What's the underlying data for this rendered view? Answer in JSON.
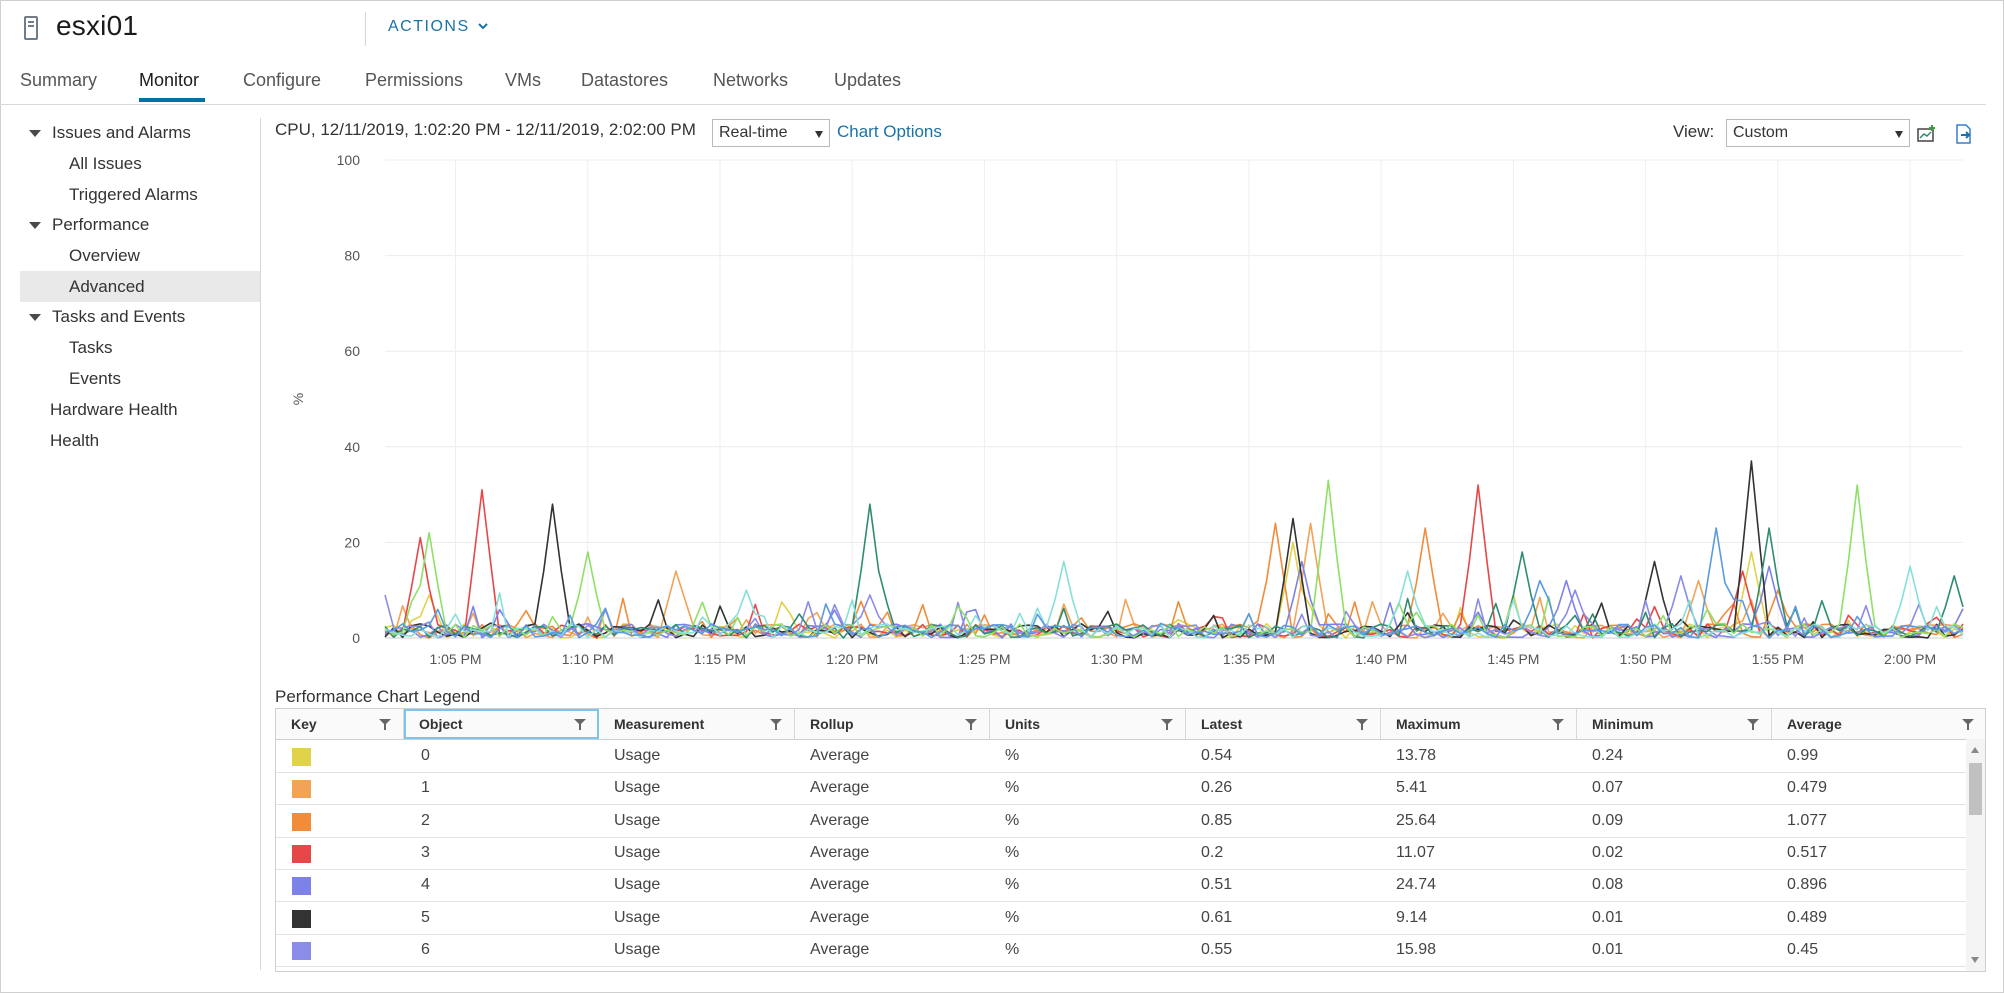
{
  "header": {
    "title": "esxi01",
    "actions_label": "ACTIONS"
  },
  "tabs": [
    {
      "label": "Summary",
      "active": false
    },
    {
      "label": "Monitor",
      "active": true
    },
    {
      "label": "Configure",
      "active": false
    },
    {
      "label": "Permissions",
      "active": false
    },
    {
      "label": "VMs",
      "active": false
    },
    {
      "label": "Datastores",
      "active": false
    },
    {
      "label": "Networks",
      "active": false
    },
    {
      "label": "Updates",
      "active": false
    }
  ],
  "sidebar": {
    "groups": [
      {
        "label": "Issues and Alarms",
        "expanded": true,
        "children": [
          "All Issues",
          "Triggered Alarms"
        ]
      },
      {
        "label": "Performance",
        "expanded": true,
        "children": [
          "Overview",
          "Advanced"
        ]
      },
      {
        "label": "Tasks and Events",
        "expanded": true,
        "children": [
          "Tasks",
          "Events"
        ]
      }
    ],
    "items": [
      "Hardware Health",
      "Health"
    ],
    "selected": "Advanced"
  },
  "chart_header": {
    "title": "CPU, 12/11/2019, 1:02:20 PM - 12/11/2019, 2:02:00 PM",
    "period_value": "Real-time",
    "chart_options_label": "Chart Options",
    "view_label": "View:",
    "view_value": "Custom",
    "icons": [
      "new-chart-icon",
      "export-icon"
    ]
  },
  "chart_data": {
    "type": "line",
    "ylabel": "%",
    "ylim": [
      0,
      100
    ],
    "yticks": [
      0,
      20,
      40,
      60,
      80,
      100
    ],
    "x_tick_labels": [
      "1:05 PM",
      "1:10 PM",
      "1:15 PM",
      "1:20 PM",
      "1:25 PM",
      "1:30 PM",
      "1:35 PM",
      "1:40 PM",
      "1:45 PM",
      "1:50 PM",
      "1:55 PM",
      "2:00 PM"
    ],
    "x_start": "1:02:20 PM",
    "x_end": "2:02:00 PM",
    "grid": true,
    "series": [
      {
        "color": "#e0d24a",
        "peaks": [
          [
            "1:04:00 PM",
            9
          ],
          [
            "1:36:40 PM",
            20
          ],
          [
            "1:54:00 PM",
            18
          ]
        ]
      },
      {
        "color": "#f2a356",
        "peaks": [
          [
            "1:13:20 PM",
            14
          ],
          [
            "1:37:20 PM",
            24
          ],
          [
            "1:52:00 PM",
            12
          ]
        ]
      },
      {
        "color": "#f08c3a",
        "peaks": [
          [
            "1:36:00 PM",
            24
          ],
          [
            "1:41:40 PM",
            23
          ],
          [
            "1:55:00 PM",
            10
          ]
        ]
      },
      {
        "color": "#e8474a",
        "peaks": [
          [
            "1:03:40 PM",
            21
          ],
          [
            "1:06:00 PM",
            31
          ],
          [
            "1:43:40 PM",
            32
          ],
          [
            "1:53:40 PM",
            14
          ]
        ]
      },
      {
        "color": "#7d82e8",
        "peaks": [
          [
            "1:37:00 PM",
            16
          ],
          [
            "1:47:00 PM",
            12
          ],
          [
            "1:54:40 PM",
            15
          ]
        ]
      },
      {
        "color": "#333333",
        "peaks": [
          [
            "1:08:40 PM",
            28
          ],
          [
            "1:36:40 PM",
            25
          ],
          [
            "1:50:20 PM",
            16
          ],
          [
            "1:54:00 PM",
            37
          ]
        ]
      },
      {
        "color": "#8b8be8",
        "peaks": [
          [
            "1:20:40 PM",
            9
          ],
          [
            "1:47:20 PM",
            10
          ],
          [
            "1:51:20 PM",
            13
          ]
        ]
      },
      {
        "color": "#2f8c73",
        "peaks": [
          [
            "1:20:40 PM",
            28
          ],
          [
            "1:45:20 PM",
            18
          ],
          [
            "1:54:40 PM",
            23
          ],
          [
            "2:01:40 PM",
            13
          ]
        ]
      },
      {
        "color": "#8ee068",
        "peaks": [
          [
            "1:04:00 PM",
            22
          ],
          [
            "1:10:00 PM",
            18
          ],
          [
            "1:38:00 PM",
            33
          ],
          [
            "1:58:00 PM",
            32
          ]
        ]
      },
      {
        "color": "#87e0d8",
        "peaks": [
          [
            "1:16:00 PM",
            10
          ],
          [
            "1:28:00 PM",
            16
          ],
          [
            "1:41:00 PM",
            14
          ],
          [
            "2:00:00 PM",
            15
          ]
        ]
      },
      {
        "color": "#5b9ae0",
        "peaks": [
          [
            "1:46:00 PM",
            12
          ],
          [
            "1:52:40 PM",
            23
          ]
        ]
      }
    ]
  },
  "legend": {
    "title": "Performance Chart Legend",
    "columns": [
      "Key",
      "Object",
      "Measurement",
      "Rollup",
      "Units",
      "Latest",
      "Maximum",
      "Minimum",
      "Average"
    ],
    "rows": [
      {
        "key_color": "#e0d24a",
        "object": "0",
        "measurement": "Usage",
        "rollup": "Average",
        "units": "%",
        "latest": "0.54",
        "maximum": "13.78",
        "minimum": "0.24",
        "average": "0.99"
      },
      {
        "key_color": "#f2a356",
        "object": "1",
        "measurement": "Usage",
        "rollup": "Average",
        "units": "%",
        "latest": "0.26",
        "maximum": "5.41",
        "minimum": "0.07",
        "average": "0.479"
      },
      {
        "key_color": "#f08c3a",
        "object": "2",
        "measurement": "Usage",
        "rollup": "Average",
        "units": "%",
        "latest": "0.85",
        "maximum": "25.64",
        "minimum": "0.09",
        "average": "1.077"
      },
      {
        "key_color": "#e8474a",
        "object": "3",
        "measurement": "Usage",
        "rollup": "Average",
        "units": "%",
        "latest": "0.2",
        "maximum": "11.07",
        "minimum": "0.02",
        "average": "0.517"
      },
      {
        "key_color": "#7d82e8",
        "object": "4",
        "measurement": "Usage",
        "rollup": "Average",
        "units": "%",
        "latest": "0.51",
        "maximum": "24.74",
        "minimum": "0.08",
        "average": "0.896"
      },
      {
        "key_color": "#333333",
        "object": "5",
        "measurement": "Usage",
        "rollup": "Average",
        "units": "%",
        "latest": "0.61",
        "maximum": "9.14",
        "minimum": "0.01",
        "average": "0.489"
      },
      {
        "key_color": "#8b8be8",
        "object": "6",
        "measurement": "Usage",
        "rollup": "Average",
        "units": "%",
        "latest": "0.55",
        "maximum": "15.98",
        "minimum": "0.01",
        "average": "0.45"
      }
    ],
    "partial_row_color": "#8fb7e8"
  },
  "colors": {
    "accent": "#0072a3",
    "link": "#1a73a8"
  }
}
